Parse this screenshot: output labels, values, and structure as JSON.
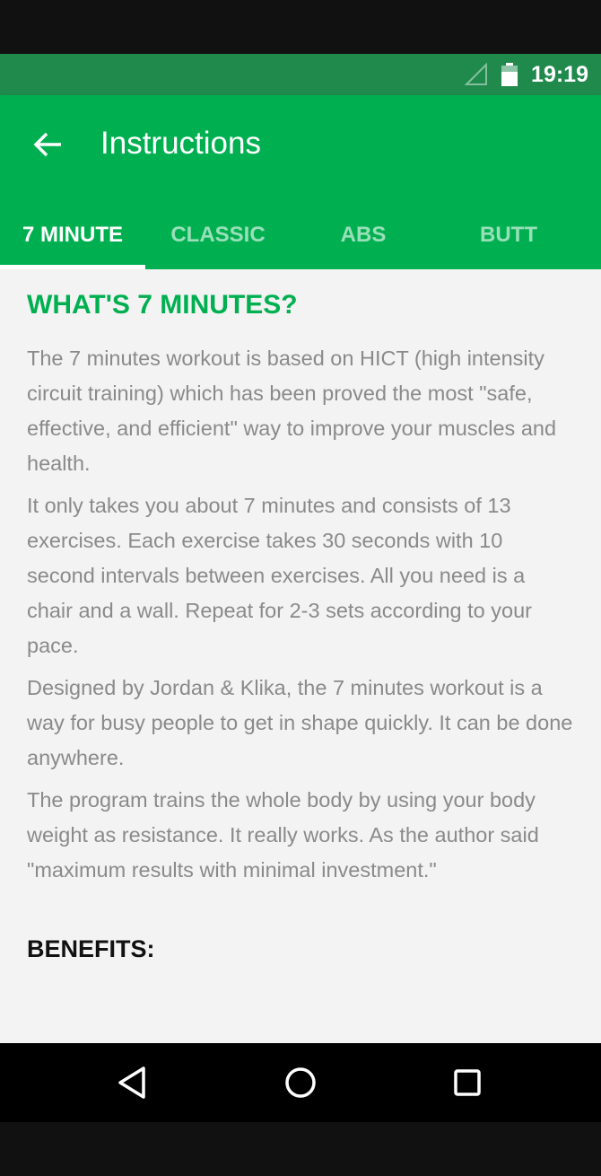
{
  "status_bar": {
    "time": "19:19",
    "icons": [
      "signal-icon",
      "battery-icon"
    ]
  },
  "app_bar": {
    "back_icon": "arrow-left-icon",
    "title": "Instructions"
  },
  "tabs": [
    {
      "label": "7 MINUTE",
      "active": true
    },
    {
      "label": "CLASSIC",
      "active": false
    },
    {
      "label": "ABS",
      "active": false
    },
    {
      "label": "BUTT",
      "active": false
    }
  ],
  "content": {
    "heading": "WHAT'S 7 MINUTES?",
    "paragraphs": [
      "The 7 minutes workout is based on HICT (high intensity circuit training) which has been proved the most \"safe, effective, and efficient\" way to improve your muscles and health.",
      "It only takes you about 7 minutes and consists of 13 exercises. Each exercise takes 30 seconds with 10 second intervals between exercises. All you need is a chair and a wall. Repeat for 2-3 sets according to your pace.",
      "Designed by Jordan & Klika, the 7 minutes workout is a way for busy people to get in shape quickly. It can be done anywhere.",
      "The program trains the whole body by using your body weight as resistance. It really works. As the author said \"maximum results with minimal investment.\""
    ],
    "benefits_heading": "BENEFITS:"
  },
  "nav_bar": {
    "icons": [
      "back-triangle-icon",
      "home-circle-icon",
      "recents-square-icon"
    ]
  },
  "colors": {
    "primary": "#00b050",
    "status_bar": "#1f8a4c",
    "text_body": "#8a8a8a",
    "background": "#f3f3f3"
  }
}
